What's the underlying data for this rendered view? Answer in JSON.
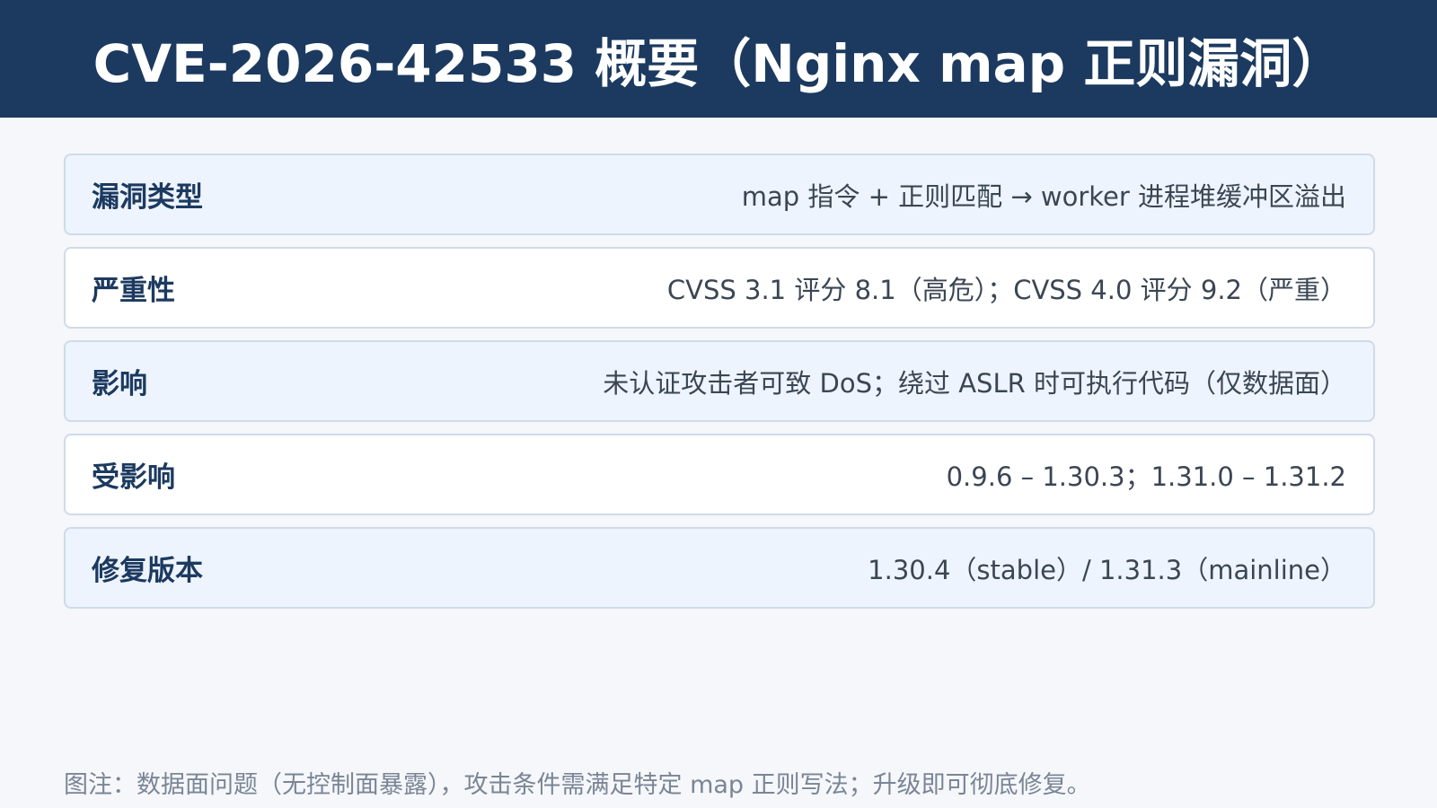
{
  "title": "CVE-2026-42533 概要（Nginx map 正则漏洞）",
  "rows": [
    {
      "label": "漏洞类型",
      "value": "map 指令 + 正则匹配 → worker 进程堆缓冲区溢出"
    },
    {
      "label": "严重性",
      "value": "CVSS 3.1 评分 8.1（高危）；CVSS 4.0 评分 9.2（严重）"
    },
    {
      "label": "影响",
      "value": "未认证攻击者可致 DoS；绕过 ASLR 时可执行代码（仅数据面）"
    },
    {
      "label": "受影响",
      "value": "0.9.6 – 1.30.3；1.31.0 – 1.31.2"
    },
    {
      "label": "修复版本",
      "value": "1.30.4（stable）/ 1.31.3（mainline）"
    }
  ],
  "footnote": "图注：数据面问题（无控制面暴露），攻击条件需满足特定 map 正则写法；升级即可彻底修复。",
  "colors": {
    "header_bg": "#1c3a60",
    "label": "#1c3a60",
    "row_alt_bg": "#eef4fd",
    "row_border": "#cfdbe9"
  }
}
